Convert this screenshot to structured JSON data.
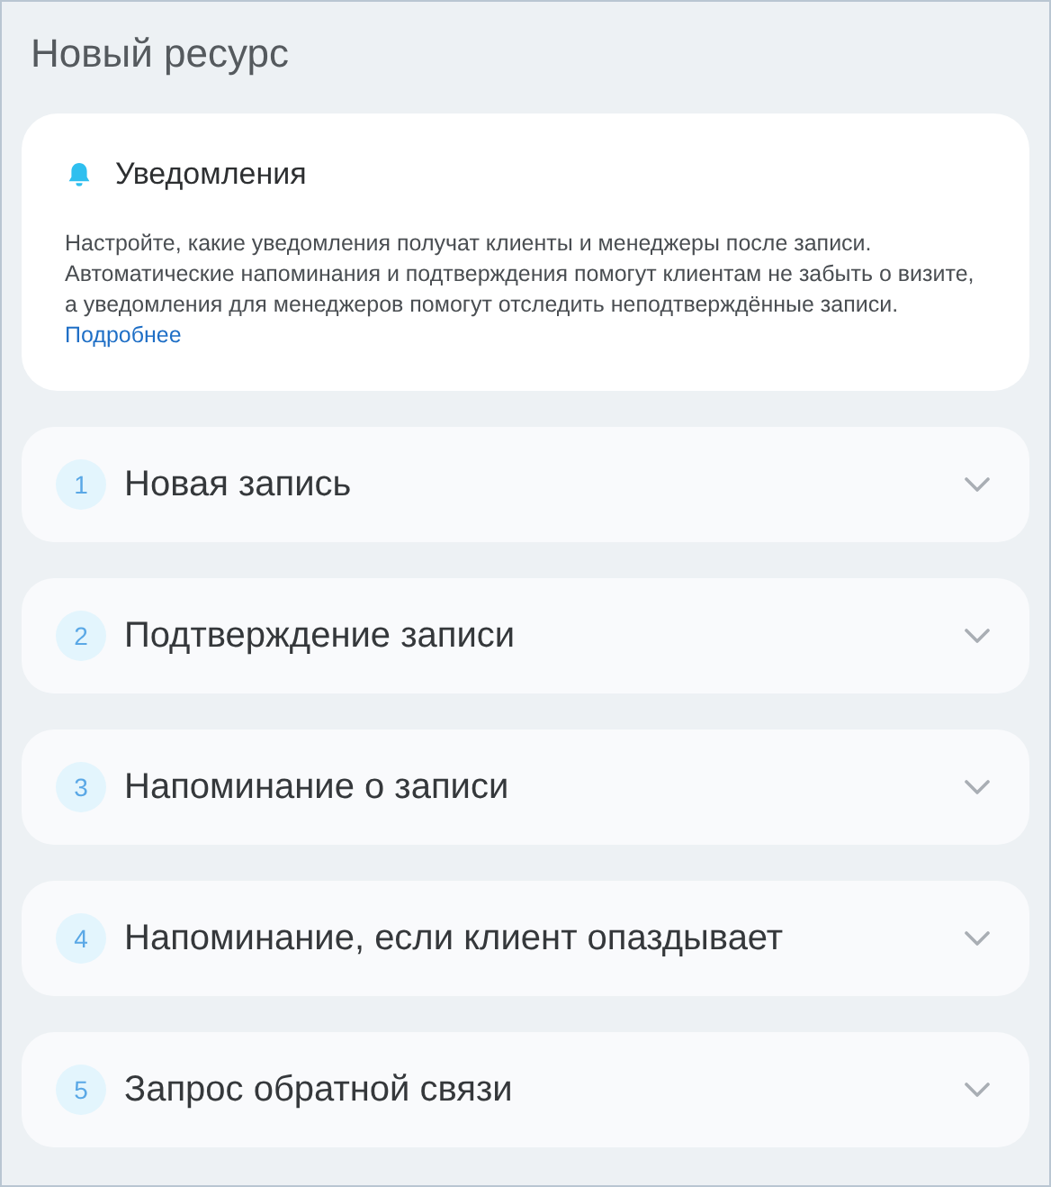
{
  "page": {
    "title": "Новый ресурс"
  },
  "info_card": {
    "title": "Уведомления",
    "text": "Настройте, какие уведомления получат клиенты и менеджеры после записи. Автоматические напоминания и подтверждения помогут клиентам не забыть о визите, а уведомления для менеджеров помогут отследить неподтверждённые записи.",
    "link": "Подробнее"
  },
  "sections": [
    {
      "number": "1",
      "title": "Новая запись",
      "expanded": false
    },
    {
      "number": "2",
      "title": "Подтверждение записи",
      "expanded": false
    },
    {
      "number": "3",
      "title": "Напоминание о записи",
      "expanded": false
    },
    {
      "number": "4",
      "title": "Напоминание, если клиент опаздывает",
      "expanded": false
    },
    {
      "number": "5",
      "title": "Запрос обратной связи",
      "expanded": false
    }
  ]
}
